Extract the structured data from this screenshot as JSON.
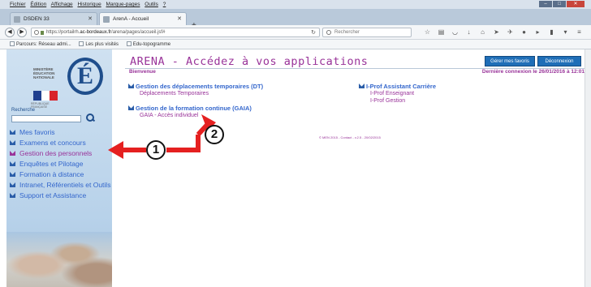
{
  "menubar": {
    "items": [
      "Fichier",
      "Édition",
      "Affichage",
      "Historique",
      "Marque-pages",
      "Outils",
      "?"
    ]
  },
  "tabs": [
    {
      "label": "DSDEN 33"
    },
    {
      "label": "ArenA - Accueil"
    }
  ],
  "nav": {
    "url_prefix": "https://portailrh.",
    "url_domain": "ac-bordeaux.fr",
    "url_suffix": "/arena/pages/accueil.jsf#",
    "search_placeholder": "Rechercher"
  },
  "bookmarks": [
    "Parcours: Réseau admi...",
    "Les plus visités",
    "Edu-topogramme"
  ],
  "sidebar": {
    "recherche_label": "Recherche",
    "menu": [
      {
        "label": "Mes favoris"
      },
      {
        "label": "Examens et concours"
      },
      {
        "label": "Gestion des personnels",
        "active": true
      },
      {
        "label": "Enquêtes et Pilotage"
      },
      {
        "label": "Formation à distance"
      },
      {
        "label": "Intranet, Référentiels et Outils"
      },
      {
        "label": "Support et Assistance"
      }
    ]
  },
  "main": {
    "title": "ARENA - Accédez à vos applications",
    "btn_favoris": "Gérer mes favoris",
    "btn_logout": "Déconnexion",
    "bienvenue": "Bienvenue",
    "last_connection": "Dernière connexion le 26/01/2016 à 12:01",
    "sections": [
      {
        "title": "Gestion des déplacements temporaires (DT)",
        "links": [
          "Déplacements Temporaires"
        ]
      },
      {
        "title": "Gestion de la formation continue (GAIA)",
        "links": [
          "GAIA - Accès individuel"
        ]
      },
      {
        "title": "I-Prof Assistant Carrière",
        "links": [
          "I-Prof Enseignant",
          "I-Prof Gestion"
        ]
      }
    ],
    "footer": "© MEN 2015 - Contact - v.2.5 - 20/02/2015"
  },
  "annotations": {
    "one": "1",
    "two": "2"
  },
  "colors": {
    "accent": "#993399",
    "link": "#3366cc",
    "arrow": "#e52020"
  }
}
